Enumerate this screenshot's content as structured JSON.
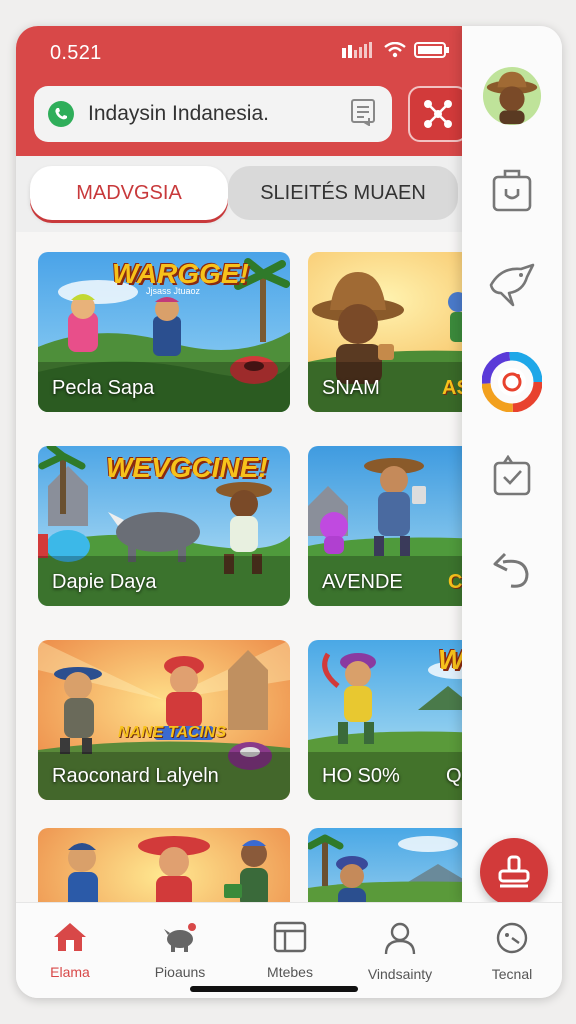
{
  "status_bar": {
    "time": "0.521"
  },
  "search": {
    "value": "Indaysin Indanesia.",
    "leading_icon": "phone-icon",
    "trailing_icon": "bookmark-icon"
  },
  "header": {
    "share_icon": "share-icon",
    "color": "#d84848"
  },
  "tabs": [
    {
      "label": "MADVGSIA",
      "active": true
    },
    {
      "label": "SLIEITÉS MUAEN",
      "active": false
    }
  ],
  "cards": [
    {
      "label": "Pecla Sapa",
      "banner": "WARGGE!",
      "subtitle": "Jjsass Jtuaoz",
      "badge": ""
    },
    {
      "label": "SNAM",
      "banner": "",
      "subtitle": "",
      "badge": "AS"
    },
    {
      "label": "Dapie Daya",
      "banner": "WEVGCINE!",
      "subtitle": "",
      "badge": ""
    },
    {
      "label": "AVENDE",
      "banner": "",
      "subtitle": "",
      "badge": "C"
    },
    {
      "label": "Raoconard Lalyeln",
      "banner": "",
      "subtitle": "NANE TACINS",
      "badge": ""
    },
    {
      "label": "HO S0%",
      "banner": "W",
      "subtitle": "",
      "badge": "Q"
    },
    {
      "label": "",
      "banner": "",
      "subtitle": "",
      "badge": ""
    },
    {
      "label": "",
      "banner": "",
      "subtitle": "",
      "badge": ""
    }
  ],
  "bottom_nav": [
    {
      "label": "Elama",
      "icon": "home-icon",
      "active": true
    },
    {
      "label": "Pioauns",
      "icon": "rhino-icon",
      "active": false
    },
    {
      "label": "Mtebes",
      "icon": "calendar-icon",
      "active": false
    },
    {
      "label": "Vindsainty",
      "icon": "user-icon",
      "active": false
    },
    {
      "label": "Tecnal",
      "icon": "clock-icon",
      "active": false
    }
  ],
  "side_rail": [
    {
      "icon": "avatar-icon"
    },
    {
      "icon": "bag-icon"
    },
    {
      "icon": "bird-icon"
    },
    {
      "icon": "color-ring-icon"
    },
    {
      "icon": "check-icon"
    },
    {
      "icon": "undo-icon"
    }
  ],
  "fab": {
    "icon": "stamp-icon"
  },
  "colors": {
    "accent": "#d84848",
    "active_tab_text": "#c8393b",
    "banner_gold": "#f7c21b"
  }
}
